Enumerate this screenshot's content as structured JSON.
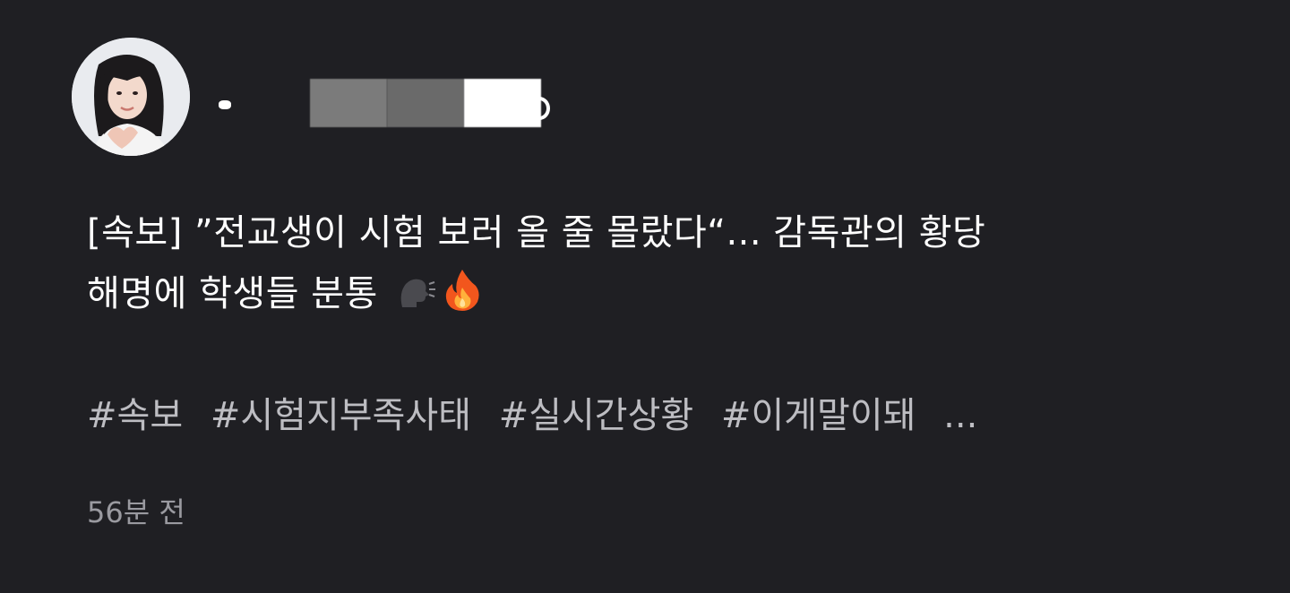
{
  "post": {
    "title_line1": "[속보] ”전교생이 시험 보러 올 줄 몰랐다“... 감독관의 황당",
    "title_line2": "해명에 학생들 분통",
    "title_emojis": "speaking-head-icon, fire-icon",
    "hashtags": [
      "#속보",
      "#시험지부족사태",
      "#실시간상황",
      "#이게말이돼"
    ],
    "hashtags_more": "...",
    "timestamp": "56분 전"
  },
  "colors": {
    "background": "#1f1f23",
    "title_text": "#ffffff",
    "hashtag_text": "#bdbdc2",
    "timestamp_text": "#9a9aa0"
  }
}
